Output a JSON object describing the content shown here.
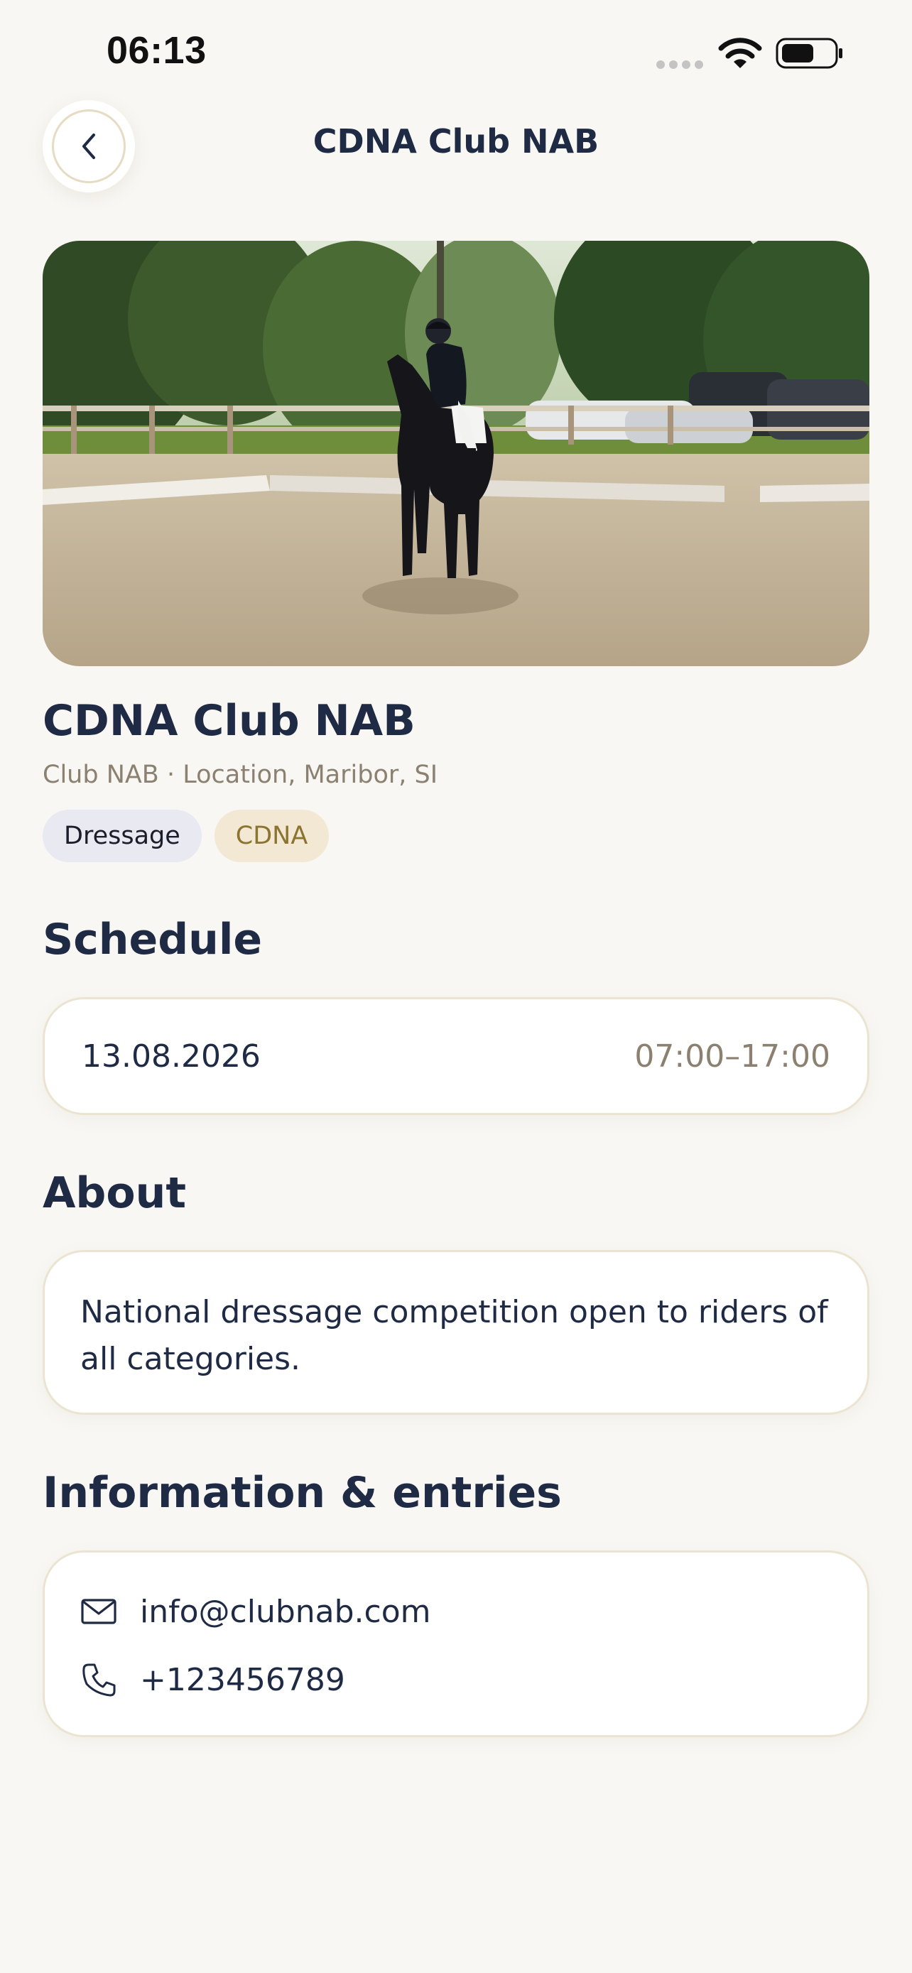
{
  "status_bar": {
    "time": "06:13",
    "icons": [
      "signal-icon",
      "wifi-icon",
      "battery-icon"
    ]
  },
  "header": {
    "title": "CDNA Club NAB",
    "back_icon": "chevron-left-icon"
  },
  "event": {
    "title": "CDNA Club NAB",
    "subtitle": "Club NAB · Location, Maribor, SI",
    "tags": [
      {
        "label": "Dressage"
      },
      {
        "label": "CDNA"
      }
    ]
  },
  "schedule": {
    "heading": "Schedule",
    "date": "13.08.2026",
    "time": "07:00–17:00"
  },
  "about": {
    "heading": "About",
    "text": "National dressage competition open to riders of all categories."
  },
  "contact": {
    "heading": "Information & entries",
    "email": "info@clubnab.com",
    "phone": "+123456789",
    "email_icon": "mail-icon",
    "phone_icon": "phone-icon"
  },
  "colors": {
    "background": "#f8f7f3",
    "text_primary": "#1f2a44",
    "text_muted": "#8c8170",
    "tag_dressage_bg": "#e8e9f1",
    "tag_cdna_bg": "#f2e8d3",
    "tag_cdna_text": "#8b7430",
    "card_border": "#ece4d2"
  }
}
